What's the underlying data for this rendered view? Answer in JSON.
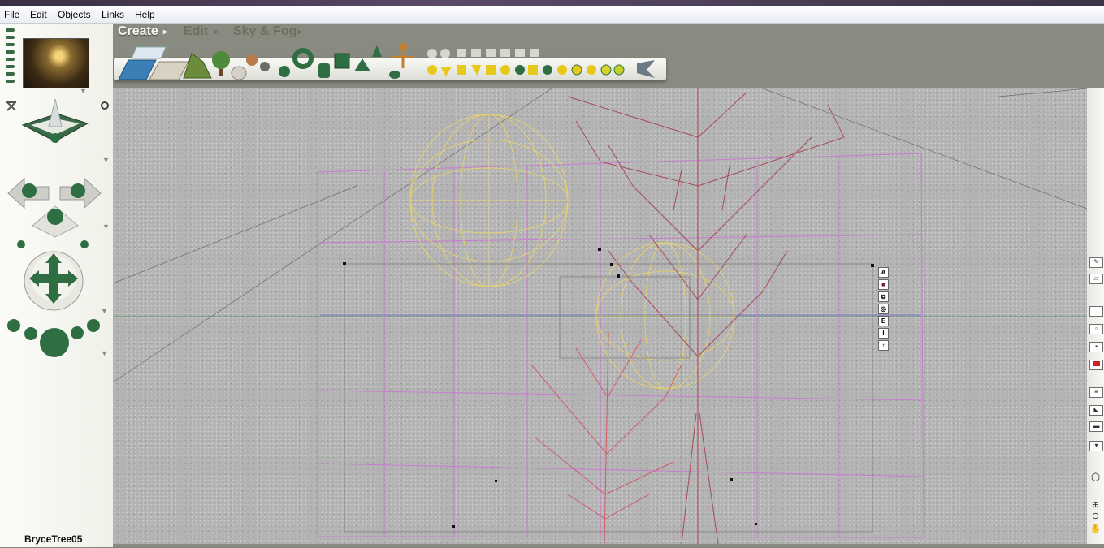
{
  "menu": [
    "File",
    "Edit",
    "Objects",
    "Links",
    "Help"
  ],
  "palette_tabs": [
    "Create",
    "Edit",
    "Sky & Fog"
  ],
  "selected_object": "BryceTree05",
  "object_controls": [
    "A",
    "■",
    "⧉",
    "◎",
    "E",
    "I",
    "↑"
  ],
  "colors": {
    "accent_green": "#2f6e43",
    "wire_pink": "#c77bd1",
    "wire_yellow": "#e8d36a",
    "tree_red": "#a64a5a",
    "horizon": "#4f9a6a"
  }
}
